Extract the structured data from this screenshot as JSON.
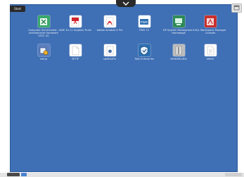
{
  "start_label": "Start",
  "icons": [
    {
      "label": "Computer Sicherheitst... Jahrlesbliche Hardware 2012 (2)",
      "icon": "excel-doc-icon",
      "color": "#3aa86b"
    },
    {
      "label": "SWE 10-11 engbins Trunk",
      "icon": "pdf-icon",
      "color": "#d2232a"
    },
    {
      "label": "Adobe Acrobat X Pro",
      "icon": "acrobat-icon",
      "color": "#ffffff"
    },
    {
      "label": "FWG 12",
      "icon": "fwg-icon",
      "color": "#ffffff"
    },
    {
      "label": "HP System Management Homepage",
      "icon": "hp-system-icon",
      "color": "#2e8b57"
    },
    {
      "label": "SQL Workspace Manager Console",
      "icon": "sql-manager-icon",
      "color": "#c9302c"
    },
    {
      "label": "setup",
      "icon": "setup-icon",
      "color": "#5b7fbf"
    },
    {
      "label": "SETIP",
      "icon": "blank-file-icon",
      "color": "#ffffff"
    },
    {
      "label": "sqsRduFix",
      "icon": "sql-file-icon",
      "color": "#ffffff"
    },
    {
      "label": "Tally Enterprise",
      "icon": "tally-icon",
      "color": "#2c6fb0"
    },
    {
      "label": "WinRAR(x64)",
      "icon": "archive-icon",
      "color": "#bdbdbd"
    },
    {
      "label": "editor",
      "icon": "document-icon",
      "color": "#ffffff"
    }
  ]
}
